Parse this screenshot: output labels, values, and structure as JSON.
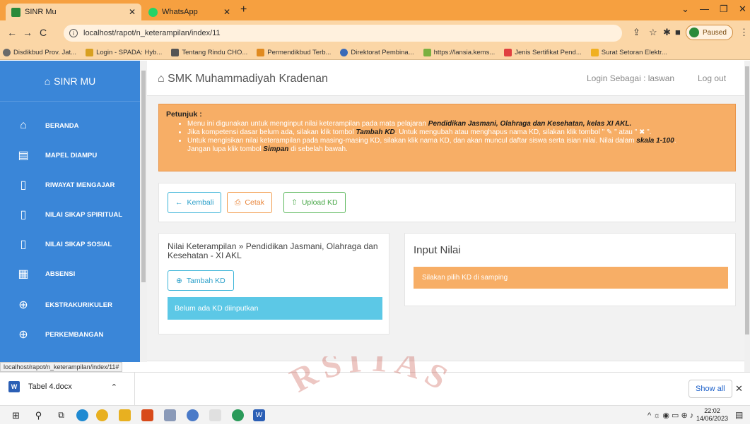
{
  "browser": {
    "tabs": [
      {
        "title": "SINR Mu",
        "active": true
      },
      {
        "title": "WhatsApp",
        "active": false
      }
    ],
    "url": "localhost/rapot/n_keterampilan/index/11",
    "profile_status": "Paused",
    "status_url": "localhost/rapot/n_keterampilan/index/11#",
    "bookmarks": [
      "Disdikbud Prov. Jat...",
      "Login - SPADA: Hyb...",
      "Tentang Rindu CHO...",
      "Permendikbud Terb...",
      "Direktorat Pembina...",
      "https://lansia.kems...",
      "Jenis Sertifikat Pend...",
      "Surat Setoran Elektr..."
    ]
  },
  "sidebar": {
    "brand": "SINR MU",
    "items": [
      {
        "label": "BERANDA",
        "icon": "home-icon"
      },
      {
        "label": "MAPEL DIAMPU",
        "icon": "book-icon"
      },
      {
        "label": "RIWAYAT MENGAJAR",
        "icon": "file-icon"
      },
      {
        "label": "NILAI SIKAP SPIRITUAL",
        "icon": "file-icon"
      },
      {
        "label": "NILAI SIKAP SOSIAL",
        "icon": "file-icon"
      },
      {
        "label": "ABSENSI",
        "icon": "calendar-icon"
      },
      {
        "label": "EKSTRAKURIKULER",
        "icon": "globe-icon"
      },
      {
        "label": "PERKEMBANGAN",
        "icon": "globe-icon"
      }
    ]
  },
  "header": {
    "school": "SMK Muhammadiyah Kradenan",
    "login_as": "Login Sebagai : laswan",
    "logout": "Log out"
  },
  "petunjuk": {
    "title": "Petunjuk :",
    "line1_pre": "Menu ini digunakan untuk menginput nilai keterampilan pada mata pelajaran ",
    "line1_bold": "Pendidikan Jasmani, Olahraga dan Kesehatan, kelas XI AKL.",
    "line2_pre": "Jika kompetensi dasar belum ada, silakan klik tombol ",
    "line2_bold": "Tambah KD",
    "line2_post": ". Untuk mengubah atau menghapus nama KD, silakan klik tombol \" ✎ \" atau \" ✖ \".",
    "line3_pre": "Untuk mengisikan nilai keterampilan pada masing-masing KD, silakan klik nama KD, dan akan muncul daftar siswa serta isian nilai. Nilai dalam ",
    "line3_bold": "skala 1-100",
    "line3_post": ".",
    "line4_pre": "Jangan lupa klik tombol ",
    "line4_bold": "Simpan",
    "line4_post": " di sebelah bawah."
  },
  "buttons": {
    "kembali": "Kembali",
    "cetak": "Cetak",
    "upload": "Upload KD"
  },
  "kd": {
    "title": "Nilai Keterampilan » Pendidikan Jasmani, Olahraga dan Kesehatan - XI AKL",
    "tambah": "Tambah KD",
    "empty": "Belum ada KD diinputkan"
  },
  "input_nilai": {
    "title": "Input Nilai",
    "alert": "Silakan pilih KD di samping"
  },
  "downloads": {
    "file": "Tabel 4.docx",
    "show_all": "Show all"
  },
  "taskbar": {
    "time": "22:02",
    "date": "14/06/2023"
  },
  "watermark": {
    "text": "RSITAS"
  },
  "colors": {
    "sidebar": "#3a86d8",
    "warning": "#f7ae66",
    "info": "#5cc8e6",
    "tab_strip": "#f6a040"
  }
}
